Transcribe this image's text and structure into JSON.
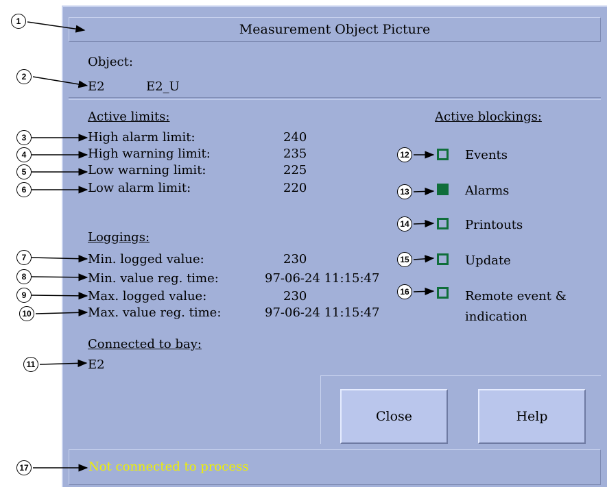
{
  "window": {
    "title": "Measurement Object Picture"
  },
  "object": {
    "label": "Object:",
    "name": "E2",
    "id": "E2_U"
  },
  "limits": {
    "header": "Active limits:",
    "items": [
      {
        "label": "High alarm limit:",
        "value": "240"
      },
      {
        "label": "High warning limit:",
        "value": "235"
      },
      {
        "label": "Low warning limit:",
        "value": "225"
      },
      {
        "label": "Low alarm limit:",
        "value": "220"
      }
    ]
  },
  "loggings": {
    "header": "Loggings:",
    "items": [
      {
        "label": "Min. logged value:",
        "value": "230"
      },
      {
        "label": "Min. value reg. time:",
        "value": "97-06-24 11:15:47"
      },
      {
        "label": "Max. logged value:",
        "value": "230"
      },
      {
        "label": "Max. value reg. time:",
        "value": "97-06-24 11:15:47"
      }
    ]
  },
  "bay": {
    "header": "Connected to bay:",
    "value": "E2"
  },
  "blockings": {
    "header": "Active blockings:",
    "items": [
      {
        "label": "Events",
        "checked": false
      },
      {
        "label": "Alarms",
        "checked": true
      },
      {
        "label": "Printouts",
        "checked": false
      },
      {
        "label": "Update",
        "checked": false
      },
      {
        "label": "Remote event &",
        "label2": "indication",
        "checked": false
      }
    ]
  },
  "buttons": {
    "close": "Close",
    "help": "Help"
  },
  "status": {
    "text": "Not connected to process"
  },
  "callouts": [
    "1",
    "2",
    "3",
    "4",
    "5",
    "6",
    "7",
    "8",
    "9",
    "10",
    "11",
    "12",
    "13",
    "14",
    "15",
    "16",
    "17"
  ],
  "colors": {
    "window": "#a2b0d8",
    "checkbox": "#0f6e3a",
    "status_text": "#f0f000",
    "button": "#bac6ec"
  }
}
